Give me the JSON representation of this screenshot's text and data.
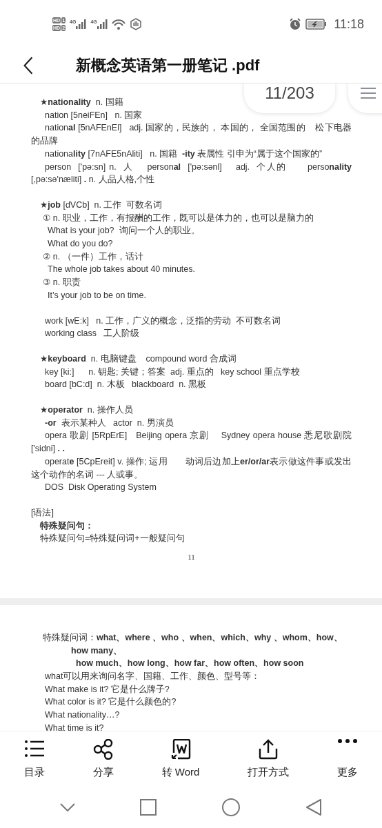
{
  "status_bar": {
    "sim_badges": [
      {
        "label": "HD",
        "slot": "1"
      },
      {
        "label": "HD",
        "slot": "2"
      }
    ],
    "signals": [
      {
        "label": "4G"
      },
      {
        "label": "4G"
      }
    ],
    "time": "11:18"
  },
  "header": {
    "title": "新概念英语第一册笔记 .pdf"
  },
  "page_indicator": {
    "text": "11/203"
  },
  "pages": [
    {
      "blocks": [
        {
          "lines": [
            {
              "kind": "head",
              "text": "★**nationality**  n. 国籍"
            },
            {
              "kind": "line",
              "text": "nation [5neiFEn]   n. 国家"
            },
            {
              "kind": "line",
              "text": "nation**al** [5nAFEnEl]   adj. 国家的，民族的， 本国的， 全国范围的    松下电器的品牌"
            },
            {
              "kind": "line",
              "text": "nationa**lity** [7nAFE5nAliti]   n. 国籍  **-ity** 表属性 引申为“属于这个国家的”"
            },
            {
              "kind": "line",
              "text": "person  ['pə:sn] n.  人    person**al**  ['pə:sənl]    adj.  个人的      perso**nality** [,pə:sə'næliti] **.** n. 人品人格,个性"
            }
          ]
        },
        {
          "lines": [
            {
              "kind": "head",
              "text": "★**job** [dVCb]  n. 工作  可数名词"
            },
            {
              "kind": "item",
              "text": "① n. 职业，工作，有报酬的工作，既可以是体力的，也可以是脑力的"
            },
            {
              "kind": "example",
              "text": "What is your job?  询问一个人的职业。"
            },
            {
              "kind": "example",
              "text": "What do you do?"
            },
            {
              "kind": "item",
              "text": "② n. （一件）工作，话计"
            },
            {
              "kind": "example",
              "text": "The whole job takes about 40 minutes."
            },
            {
              "kind": "item",
              "text": "③ n. 职责"
            },
            {
              "kind": "example",
              "text": "It’s your job to be on time."
            }
          ]
        },
        {
          "lines": [
            {
              "kind": "line",
              "text": "work [wE:k]   n. 工作，广义的概念，泛指的劳动  不可数名词"
            },
            {
              "kind": "line",
              "text": "working class   工人阶级"
            }
          ]
        },
        {
          "lines": [
            {
              "kind": "head",
              "text": "★**keyboard**  n. 电脑键盘    compound word 合成词"
            },
            {
              "kind": "line",
              "text": "key [ki:]      n. 钥匙; 关键；答案  adj. 重点的   key school 重点学校"
            },
            {
              "kind": "line",
              "text": "board [bC:d]  n. 木板   blackboard  n. 黑板"
            }
          ]
        },
        {
          "lines": [
            {
              "kind": "head",
              "text": "★**operator**  n. 操作人员"
            },
            {
              "kind": "line",
              "text": "**-or**  表示某种人   actor  n. 男演员"
            },
            {
              "kind": "line",
              "text": "opera 歌剧 [5RpErE]   Beijing opera 京剧    Sydney opera house 悉尼歌剧院 ['sidni] **. .**"
            },
            {
              "kind": "line",
              "text": "operat**e** [5CpEreit] v. 操作; 运用       动词后边加上**er/or/ar**表示做这件事或发出这个动作的名词 --- 人或事。"
            },
            {
              "kind": "line",
              "text": "DOS  Disk Operating System"
            }
          ]
        },
        {
          "lines": [
            {
              "kind": "flush",
              "text": "[语法]"
            },
            {
              "kind": "heading",
              "text": "特殊疑问句："
            },
            {
              "kind": "head",
              "text": "特殊疑问句=特殊疑问词+一般疑问句"
            }
          ]
        }
      ],
      "page_number": "11"
    },
    {
      "blocks": [
        {
          "lines": [
            {
              "kind": "lead",
              "text": "特殊疑问词：**what、where 、who 、when、which、why 、whom、how、**"
            },
            {
              "kind": "cont1",
              "text": "how many、"
            },
            {
              "kind": "cont2",
              "text": "how much、how long、how far、how often、how soon"
            },
            {
              "kind": "line",
              "text": "what可以用来询问名字、国籍、工作、颜色、型号等："
            },
            {
              "kind": "line",
              "text": "What make is it? 它是什么牌子?"
            },
            {
              "kind": "line",
              "text": "What color is it? 它是什么颜色的?"
            },
            {
              "kind": "line",
              "text": "What nationality…?"
            },
            {
              "kind": "line",
              "text": "What time is it?"
            }
          ]
        }
      ]
    }
  ],
  "toolbar": [
    {
      "kind": "list",
      "label": "目录"
    },
    {
      "kind": "share",
      "label": "分享"
    },
    {
      "kind": "word",
      "label": "转 Word"
    },
    {
      "kind": "open",
      "label": "打开方式"
    },
    {
      "kind": "more",
      "label": "更多"
    }
  ]
}
